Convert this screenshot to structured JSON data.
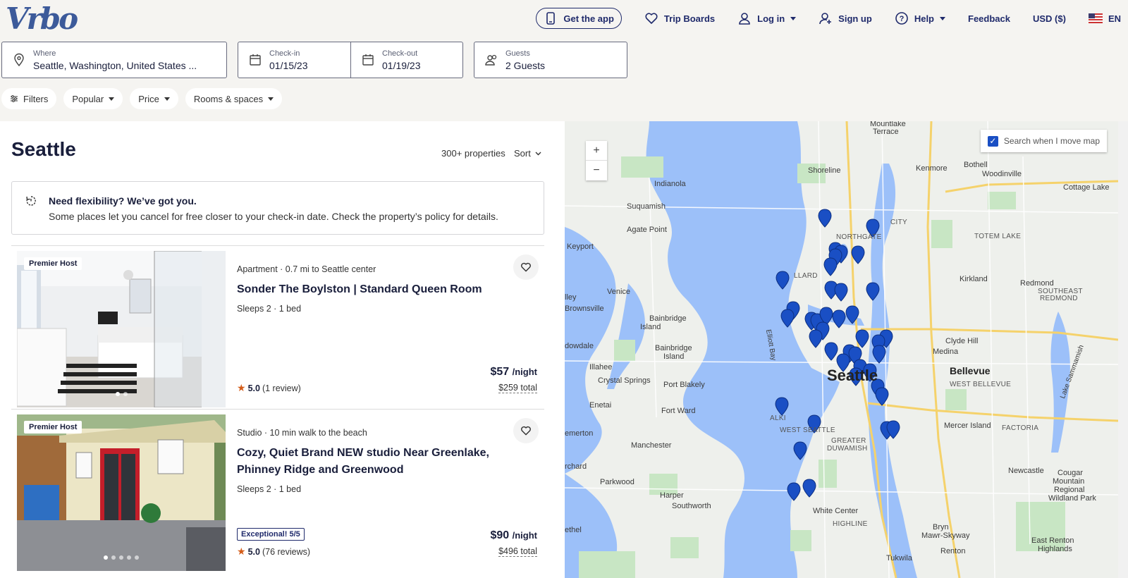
{
  "brand": {
    "logo": "Vrbo",
    "accent": "#1f2a6b",
    "pin_color": "#1a4fc4"
  },
  "nav": {
    "get_app": "Get the app",
    "trip_boards": "Trip Boards",
    "login": "Log in",
    "signup": "Sign up",
    "help": "Help",
    "feedback": "Feedback",
    "currency": "USD ($)",
    "language": "EN"
  },
  "search": {
    "where_label": "Where",
    "where_value": "Seattle, Washington, United States ...",
    "checkin_label": "Check-in",
    "checkin_value": "01/15/23",
    "checkout_label": "Check-out",
    "checkout_value": "01/19/23",
    "guests_label": "Guests",
    "guests_value": "2 Guests"
  },
  "filters": {
    "filters": "Filters",
    "popular": "Popular",
    "price": "Price",
    "rooms": "Rooms & spaces"
  },
  "results": {
    "title": "Seattle",
    "count": "300+ properties",
    "sort": "Sort",
    "notice_title": "Need flexibility? We’ve got you.",
    "notice_body": "Some places let you cancel for free closer to your check-in date. Check the property’s policy for details."
  },
  "listings": [
    {
      "badge": "Premier Host",
      "meta": "Apartment · 0.7 mi to Seattle center",
      "name": "Sonder The Boylston | Standard Queen Room",
      "sleeps": "Sleeps 2 · 1 bed",
      "rating": "5.0",
      "reviews": "(1 review)",
      "price": "$57",
      "per_night": "/night",
      "total": "$259 total"
    },
    {
      "badge": "Premier Host",
      "meta": "Studio · 10 min walk to the beach",
      "name": "Cozy, Quiet Brand NEW studio Near Greenlake, Phinney Ridge and Greenwood",
      "sleeps": "Sleeps 2 · 1 bed",
      "tag": "Exceptional! 5/5",
      "rating": "5.0",
      "reviews": "(76 reviews)",
      "price": "$90",
      "per_night": "/night",
      "total": "$496 total"
    }
  ],
  "map": {
    "search_move": "Search when I move map",
    "zoom_in": "+",
    "zoom_out": "−",
    "labels": {
      "mountlake": "Mountlake",
      "terrace": "Terrace",
      "shoreline": "Shoreline",
      "kenmore": "Kenmore",
      "bothell": "Bothell",
      "woodinville": "Woodinville",
      "cottage_lake": "Cottage Lake",
      "indianola": "Indianola",
      "suquamish": "Suquamish",
      "agate_point": "Agate Point",
      "keyport": "Keyport",
      "totem_lake": "TOTEM LAKE",
      "northgate": "NORTHGATE",
      "city": "CITY",
      "ballard": "LLARD",
      "kirkland": "Kirkland",
      "redmond": "Redmond",
      "southeast": "SOUTHEAST",
      "redmond2": "REDMOND",
      "venice": "Venice",
      "brownsville": "Brownsville",
      "lley": "lley",
      "bainbridge_island": "Bainbridge",
      "island": "Island",
      "bainbridge2": "Bainbridge",
      "island2": "Island",
      "clyde_hill": "Clyde Hill",
      "medina": "Medina",
      "dowdale": "dowdale",
      "illahee": "Illahee",
      "bellevue": "Bellevue",
      "west_bellevue": "WEST BELLEVUE",
      "seattle": "Seattle",
      "crystal_springs": "Crystal Springs",
      "port_blakely": "Port Blakely",
      "enetai": "Enetai",
      "fort_ward": "Fort Ward",
      "alki": "ALKI",
      "west_seattle": "WEST SEATTLE",
      "mercer_island": "Mercer Island",
      "factoria": "FACTORIA",
      "emerton": "emerton",
      "manchester": "Manchester",
      "greater": "GREATER",
      "duwamish": "DUWAMISH",
      "newcastle": "Newcastle",
      "rchard": "rchard",
      "parkwood": "Parkwood",
      "cougar": "Cougar",
      "mountain": "Mountain",
      "regional": "Regional",
      "wildland": "Wildland Park",
      "harper": "Harper",
      "southworth": "Southworth",
      "white_center": "White Center",
      "highline": "HIGHLINE",
      "bryn": "Bryn",
      "mawr": "Mawr-Skyway",
      "east_renton": "East Renton",
      "highlands": "Highlands",
      "renton": "Renton",
      "tukwila": "Tukwila",
      "ethel": "ethel",
      "elliott_bay": "Elliott Bay",
      "lake_samm": "Lake Sammamish"
    }
  }
}
